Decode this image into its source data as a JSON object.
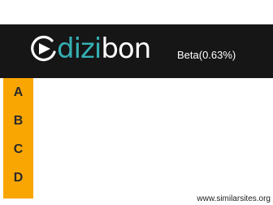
{
  "logo": {
    "text_part_1": "dizi",
    "text_part_2": "bon",
    "icon": "play-circle-icon"
  },
  "header": {
    "beta_label": "Beta(0.63%)"
  },
  "sidebar": {
    "items": [
      {
        "label": "A"
      },
      {
        "label": "B"
      },
      {
        "label": "C"
      },
      {
        "label": "D"
      }
    ]
  },
  "watermark": {
    "text": "www.similarsites.org"
  },
  "colors": {
    "header_bg": "#161616",
    "logo_accent": "#35b0b3",
    "sidebar_bg": "#f9a602"
  }
}
